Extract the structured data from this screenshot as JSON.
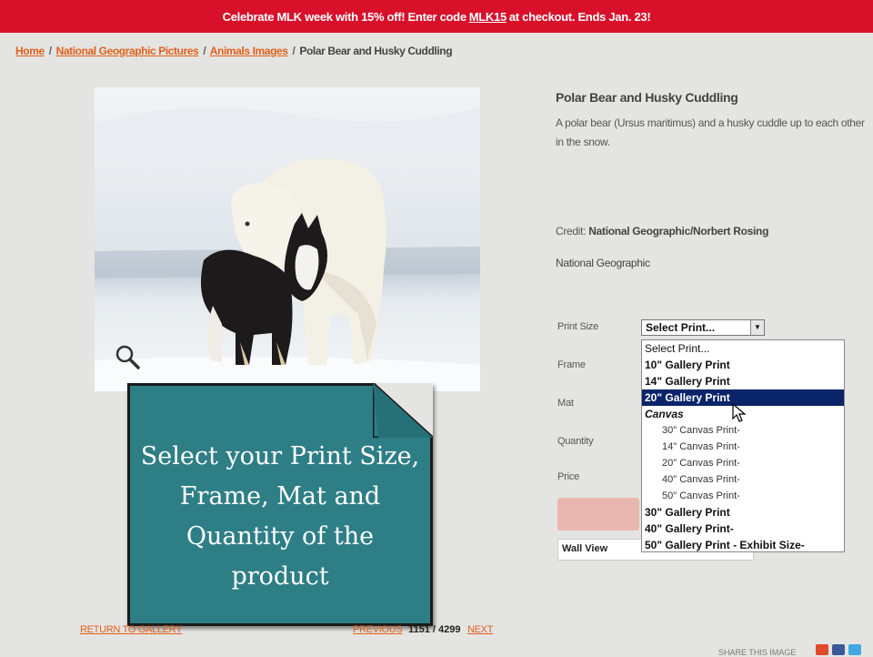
{
  "promo": {
    "text_before": "Celebrate MLK week with 15% off! Enter code",
    "code": "MLK15",
    "text_after": "at checkout. Ends Jan. 23!"
  },
  "breadcrumb": {
    "items": [
      "Home",
      "National Geographic Pictures",
      "Animals Images",
      "Polar Bear and Husky Cuddling"
    ],
    "separator": "/"
  },
  "product": {
    "title": "Polar Bear and Husky Cuddling",
    "description": "A polar bear (Ursus maritimus) and a husky cuddle up to each other in the snow.",
    "credit_label": "Credit:",
    "credit_value": "National Geographic/Norbert Rosing",
    "publisher": "National Geographic"
  },
  "form": {
    "labels": {
      "print_size": "Print Size",
      "frame": "Frame",
      "mat": "Mat",
      "quantity": "Quantity",
      "price": "Price"
    },
    "print_size_selected": "Select Print...",
    "print_size_options": [
      {
        "label": "Select Print...",
        "style": "normal"
      },
      {
        "label": "10\" Gallery Print",
        "style": "bold"
      },
      {
        "label": "14\" Gallery Print",
        "style": "bold"
      },
      {
        "label": "20\" Gallery Print",
        "style": "selected"
      },
      {
        "label": "Canvas",
        "style": "group"
      },
      {
        "label": "30\" Canvas Print-",
        "style": "indent"
      },
      {
        "label": "14\" Canvas Print-",
        "style": "indent"
      },
      {
        "label": "20\" Canvas Print-",
        "style": "indent"
      },
      {
        "label": "40\" Canvas Print-",
        "style": "indent"
      },
      {
        "label": "50\" Canvas Print-",
        "style": "indent"
      },
      {
        "label": "30\" Gallery Print",
        "style": "bold"
      },
      {
        "label": "40\" Gallery Print-",
        "style": "bold"
      },
      {
        "label": "50\" Gallery Print - Exhibit Size-",
        "style": "bold"
      }
    ],
    "wall_view_label": "Wall View"
  },
  "callout": {
    "lines": [
      "Select your Print Size,",
      "Frame, Mat and",
      "Quantity of the",
      "product"
    ]
  },
  "footer": {
    "return_link": "RETURN TO GALLERY",
    "previous_link": "PREVIOUS",
    "pager": "1151 / 4299",
    "next_link": "NEXT",
    "share_label": "SHARE THIS IMAGE"
  },
  "colors": {
    "banner": "#d8102a",
    "link": "#e0601a",
    "callout": "#2e7e86",
    "dropdown_highlight": "#0a246a"
  }
}
